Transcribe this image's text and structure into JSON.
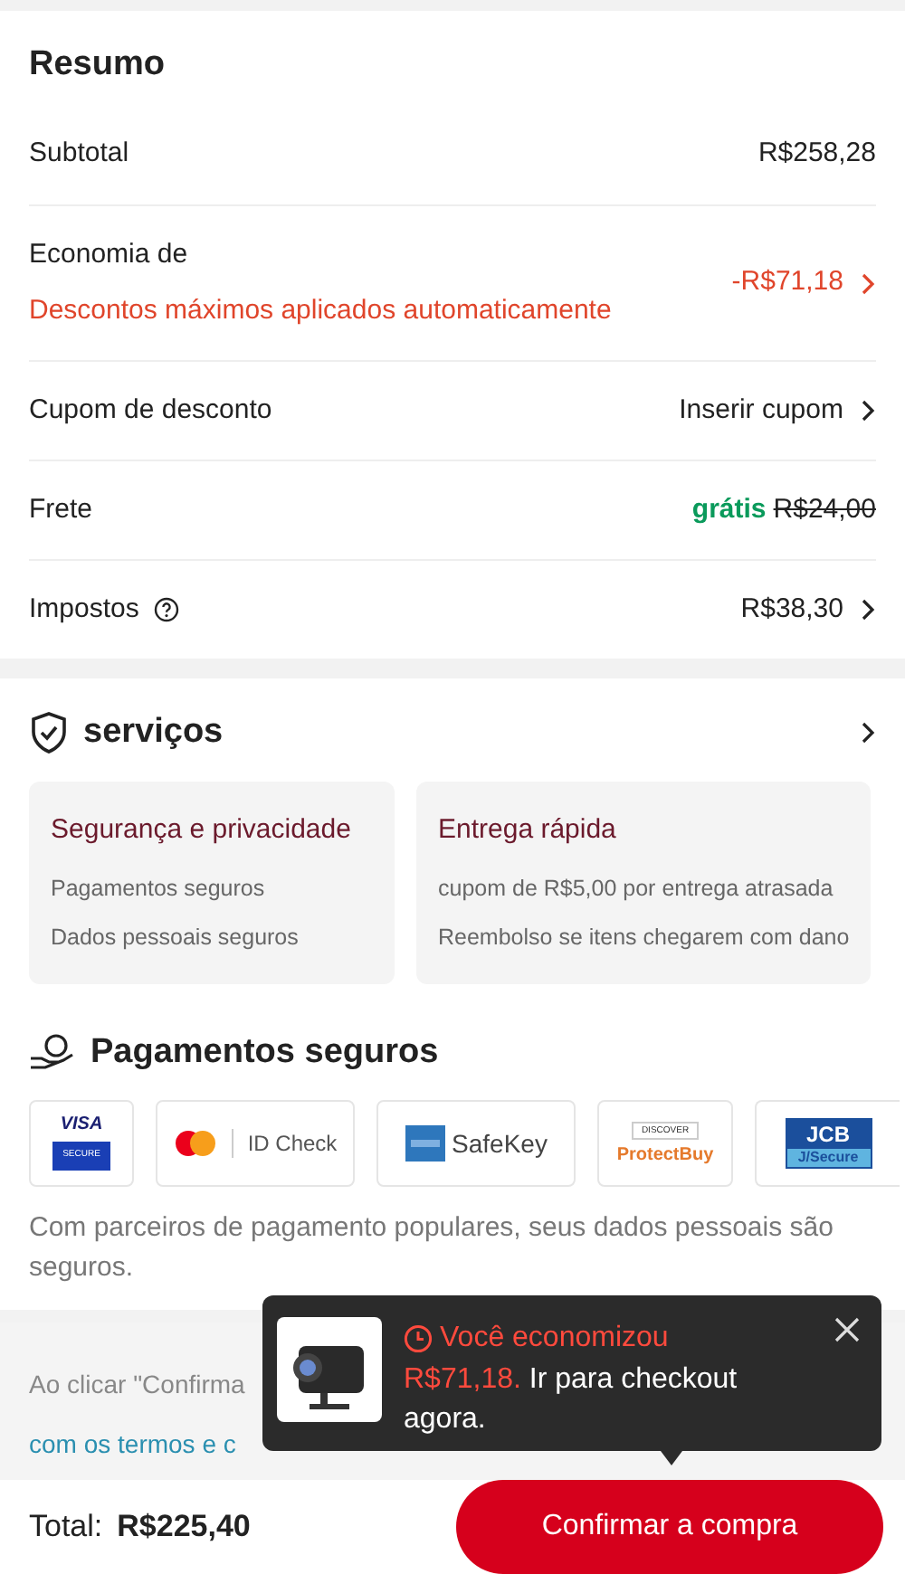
{
  "summary": {
    "title": "Resumo",
    "rows": [
      {
        "kind": "plain",
        "label": "Subtotal",
        "value": "R$258,28",
        "chevron": false
      },
      {
        "kind": "discount",
        "label": "Economia de",
        "note": "Descontos máximos aplicados automaticamente",
        "value": "-R$71,18",
        "chevron": true
      },
      {
        "kind": "plain",
        "label": "Cupom de desconto",
        "value": "Inserir cupom",
        "chevron": true
      },
      {
        "kind": "shipping",
        "label": "Frete",
        "free": "grátis",
        "old": "R$24,00",
        "chevron": false
      },
      {
        "kind": "help",
        "label": "Impostos",
        "value": "R$38,30",
        "chevron": true
      }
    ]
  },
  "services": {
    "title": "serviços",
    "cards": [
      {
        "title": "Segurança e privacidade",
        "lines": [
          "Pagamentos seguros",
          "Dados pessoais seguros"
        ]
      },
      {
        "title": "Entrega rápida",
        "lines": [
          "cupom de R$5,00 por entrega atrasada",
          "Reembolso se itens chegarem com dano"
        ]
      }
    ]
  },
  "payments": {
    "title": "Pagamentos seguros",
    "logos": [
      {
        "kind": "visa",
        "texts": [
          "VISA",
          "SECURE"
        ]
      },
      {
        "kind": "mastercard",
        "texts": [
          "ID Check"
        ]
      },
      {
        "kind": "amex",
        "texts": [
          "SafeKey"
        ]
      },
      {
        "kind": "discover",
        "texts": [
          "DISCOVER",
          "ProtectBuy"
        ]
      },
      {
        "kind": "jcb",
        "texts": [
          "JCB",
          "J/Secure"
        ]
      }
    ],
    "note": "Com parceiros de pagamento populares, seus dados pessoais são seguros."
  },
  "terms": {
    "line_1": "Ao clicar \"Confirma",
    "line_2": "com os termos e c"
  },
  "popup": {
    "headline": "Você economizou",
    "amount": "R$71,18.",
    "message": "Ir para checkout agora."
  },
  "footer": {
    "total_label": "Total:",
    "total": "R$225,40",
    "button": "Confirmar a compra"
  }
}
